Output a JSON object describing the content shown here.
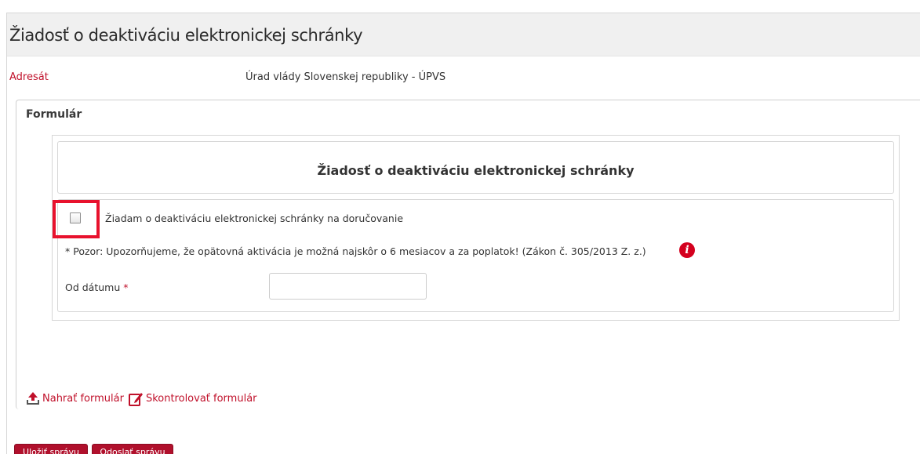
{
  "window": {
    "title": "Žiadosť o deaktiváciu elektronickej schránky"
  },
  "addressee": {
    "label": "Adresát",
    "value": "Úrad vlády Slovenskej republiky - ÚPVS"
  },
  "form": {
    "legend": "Formulár",
    "heading": "Žiadosť o deaktiváciu elektronickej schránky",
    "checkbox_label": "Žiadam o deaktiváciu elektronickej schránky na doručovanie",
    "checkbox_checked": false,
    "warning": "* Pozor: Upozorňujeme, že opätovná aktivácia je možná najskôr o 6 mesiacov a za poplatok! (Zákon č. 305/2013 Z. z.)",
    "info_icon": "info-icon",
    "date_label": "Od dátumu",
    "date_required_mark": "*",
    "date_value": "",
    "highlight_color": "#e8112d"
  },
  "actions": {
    "upload_label": "Nahrať formulár",
    "upload_icon": "upload-icon",
    "check_label": "Skontrolovať formulár",
    "check_icon": "edit-icon",
    "save_label": "Uložiť správu",
    "send_label": "Odoslať správu"
  },
  "colors": {
    "accent": "#c0102a",
    "button": "#b0102c",
    "title_bar": "#f0f0f0"
  }
}
